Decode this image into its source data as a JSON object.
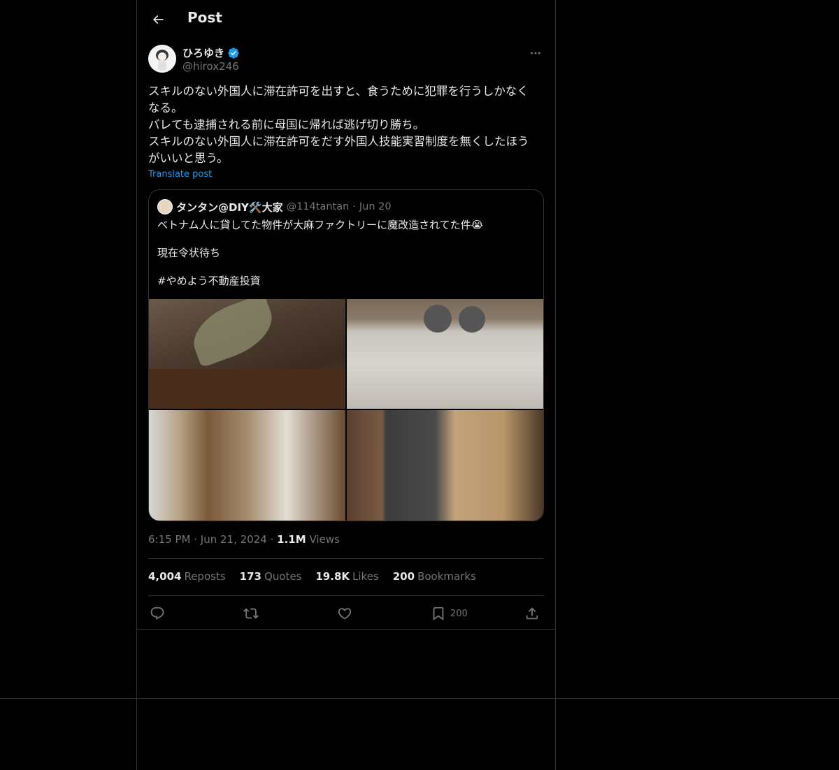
{
  "header": {
    "title": "Post"
  },
  "author": {
    "name": "ひろゆき",
    "handle": "@hirox246",
    "verified": true
  },
  "post": {
    "text": "スキルのない外国人に滞在許可を出すと、食うために犯罪を行うしかなく\nなる。\nバレても逮捕される前に母国に帰れば逃げ切り勝ち。\nスキルのない外国人に滞在許可をだす外国人技能実習制度を無くしたほう\nがいいと思う。",
    "translate_label": "Translate post"
  },
  "quote": {
    "name": "タンタン@DIY🛠️大家",
    "handle": "@114tantan",
    "separator": "·",
    "date": "Jun 20",
    "text": "ベトナム人に貸してた物件が大麻ファクトリーに魔改造されてた件😭\n\n現在令状待ち\n\n#やめよう不動産投資"
  },
  "meta": {
    "time": "6:15 PM",
    "separator": "·",
    "date": "Jun 21, 2024",
    "views_count": "1.1M",
    "views_label": "Views"
  },
  "stats": [
    {
      "count": "4,004",
      "label": "Reposts"
    },
    {
      "count": "173",
      "label": "Quotes"
    },
    {
      "count": "19.8K",
      "label": "Likes"
    },
    {
      "count": "200",
      "label": "Bookmarks"
    }
  ],
  "actions": {
    "bookmark_count": "200"
  },
  "colors": {
    "accent": "#1d9bf0",
    "background": "#000000",
    "border": "#2f3336",
    "muted": "#71767b",
    "text": "#e7e9ea"
  },
  "icons": [
    "back-arrow-icon",
    "verified-badge-icon",
    "more-icon",
    "reply-icon",
    "repost-icon",
    "like-icon",
    "bookmark-icon",
    "share-icon"
  ]
}
